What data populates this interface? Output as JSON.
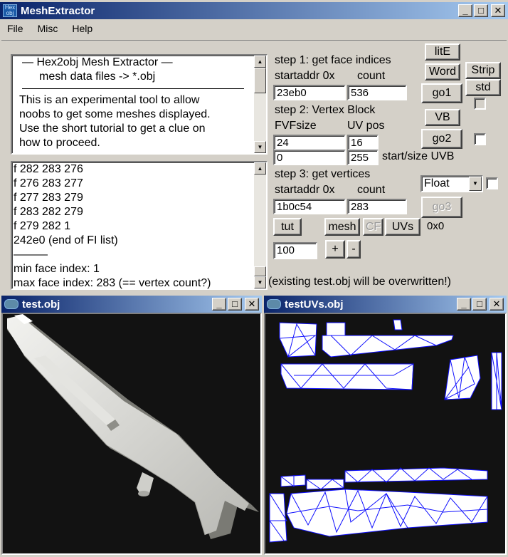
{
  "app": {
    "title": "MeshExtractor",
    "icon_text": "Hex obj",
    "controls": [
      "_",
      "□",
      "✕"
    ]
  },
  "menu": [
    {
      "label": "File",
      "accel": "F"
    },
    {
      "label": "Misc",
      "accel": "M"
    },
    {
      "label": "Help",
      "accel": "H"
    }
  ],
  "info": {
    "lines": [
      "—   Hex2obj Mesh Extractor   —",
      "mesh data files -> *.obj",
      "This is an experimental tool to allow",
      "noobs to get some meshes displayed.",
      "Use the short tutorial to get a clue on",
      "how to proceed."
    ]
  },
  "log": {
    "lines": [
      "f  282 283 276",
      "f  276 283 277",
      "f  277 283 279",
      "f  283 282 279",
      "f  279 282 1",
      "242e0 (end of FI list)",
      "———",
      "min face index: 1",
      "max face index: 283 (== vertex count?)"
    ]
  },
  "step1": {
    "title": "step 1: get face indices",
    "startaddr_label": "startaddr 0x",
    "count_label": "count",
    "startaddr": "23eb0",
    "count": "536"
  },
  "step2": {
    "title": "step 2: Vertex Block",
    "fvf_label": "FVFsize",
    "uvpos_label": "UV pos",
    "fvfsize": "24",
    "uvpos": "16",
    "uvb_start": "0",
    "uvb_size": "255",
    "uvb_label": "start/size UVB"
  },
  "step3": {
    "title": "step 3: get vertices",
    "startaddr_label": "startaddr 0x",
    "count_label": "count",
    "startaddr": "1b0c54",
    "count": "283",
    "format": "Float"
  },
  "buttons": {
    "lite": "litE",
    "word": "Word",
    "strip": "Strip",
    "std": "std",
    "go1": "go1",
    "vb": "VB",
    "go2": "go2",
    "go3": "go3",
    "tut": "tut",
    "mesh": "mesh",
    "cf": "CF",
    "uvs": "UVs",
    "plus": "+",
    "minus": "-"
  },
  "misc": {
    "uv_readout": "0x0",
    "scale": "100",
    "warning": "(existing test.obj will be overwritten!)"
  },
  "windows": {
    "mesh_title": "test.obj",
    "uv_title": "testUVs.obj"
  },
  "colors": {
    "titlebar_start": "#0a246a",
    "titlebar_end": "#a6caf0",
    "viewport_bg": "#121212",
    "uv_line": "#0000ff",
    "mesh_color": "#d9d9d5"
  }
}
